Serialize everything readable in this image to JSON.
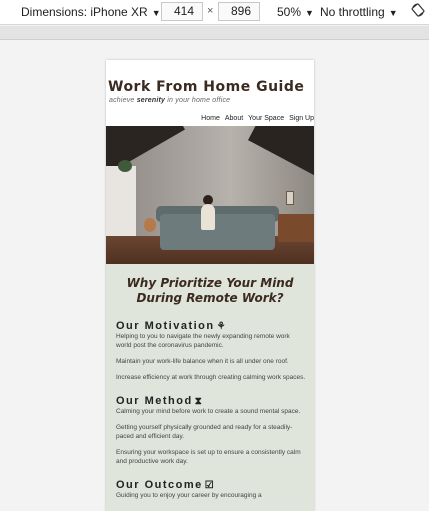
{
  "devtools": {
    "dimensions_label": "Dimensions: iPhone XR",
    "width": "414",
    "times": "×",
    "height": "896",
    "zoom": "50%",
    "throttling": "No throttling"
  },
  "site": {
    "title": "Work From Home Guide",
    "tagline_prefix": "achieve",
    "tagline_emphasis": "serenity",
    "tagline_suffix": "in your home office",
    "nav": [
      "Home",
      "About",
      "Your Space",
      "Sign Up"
    ]
  },
  "main": {
    "heading": "Why Prioritize Your Mind During Remote Work?",
    "sections": [
      {
        "title": "Our Motivation",
        "icon": "⚘",
        "icon_name": "plant-icon",
        "paragraphs": [
          "Helping to you to navigate the newly expanding remote work world post the coronavirus pandemic.",
          "Maintain your work-life balance when it is all under one roof.",
          "Increase efficiency at work through creating calming work spaces."
        ]
      },
      {
        "title": "Our Method",
        "icon": "⧗",
        "icon_name": "hourglass-icon",
        "paragraphs": [
          "Calming your mind before work to create a sound mental space.",
          "Getting yourself physically grounded and ready for a steadily-paced and efficient day.",
          "Ensuring your workspace is set up to ensure a consistently calm and productive work day."
        ]
      },
      {
        "title": "Our Outcome",
        "icon": "☑",
        "icon_name": "checkbox-icon",
        "paragraphs": [
          "Guiding you to enjoy your career by encouraging a"
        ]
      }
    ]
  }
}
